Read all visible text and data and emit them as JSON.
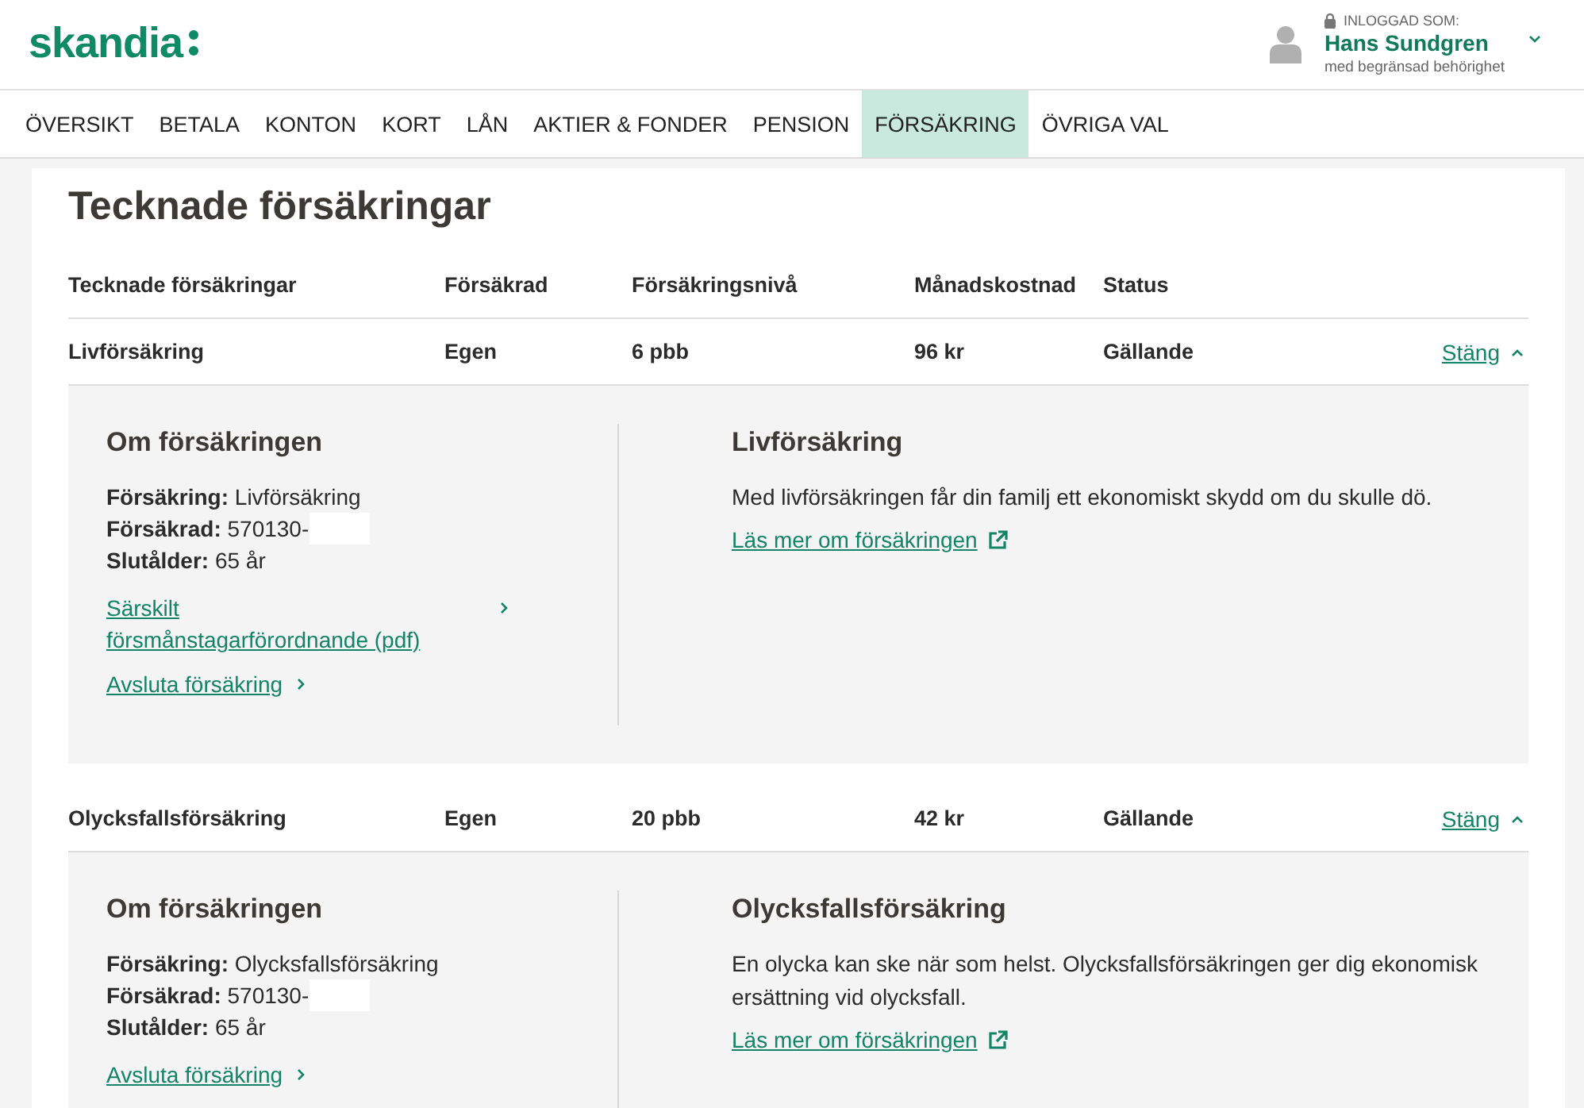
{
  "header": {
    "logo": "skandia",
    "login_label": "INLOGGAD SOM:",
    "user_name": "Hans Sundgren",
    "user_note": "med begränsad behörighet"
  },
  "nav": [
    {
      "label": "ÖVERSIKT",
      "selected": false
    },
    {
      "label": "BETALA",
      "selected": false
    },
    {
      "label": "KONTON",
      "selected": false
    },
    {
      "label": "KORT",
      "selected": false
    },
    {
      "label": "LÅN",
      "selected": false
    },
    {
      "label": "AKTIER & FONDER",
      "selected": false
    },
    {
      "label": "PENSION",
      "selected": false
    },
    {
      "label": "FÖRSÄKRING",
      "selected": true
    },
    {
      "label": "ÖVRIGA VAL",
      "selected": false
    }
  ],
  "page_title": "Tecknade försäkringar",
  "table": {
    "columns": [
      "Tecknade försäkringar",
      "Försäkrad",
      "Försäkringsnivå",
      "Månadskostnad",
      "Status"
    ],
    "rows": [
      {
        "cells": [
          "Livförsäkring",
          "Egen",
          "6 pbb",
          "96 kr",
          "Gällande"
        ],
        "toggle": "Stäng",
        "expanded": true,
        "details": {
          "heading": "Om försäkringen",
          "facts": [
            {
              "label": "Försäkring:",
              "value": "Livförsäkring"
            },
            {
              "label": "Försäkrad:",
              "value": "570130-",
              "redacted": true
            },
            {
              "label": "Slutålder:",
              "value": "65 år"
            }
          ],
          "links": [
            "Särskilt försmånstagarförordnande (pdf)",
            "Avsluta försäkring"
          ],
          "info_heading": "Livförsäkring",
          "info_text": "Med livförsäkringen får din familj ett ekonomiskt skydd om du skulle dö.",
          "read_more": "Läs mer om försäkringen"
        }
      },
      {
        "cells": [
          "Olycksfallsförsäkring",
          "Egen",
          "20 pbb",
          "42 kr",
          "Gällande"
        ],
        "toggle": "Stäng",
        "expanded": true,
        "details": {
          "heading": "Om försäkringen",
          "facts": [
            {
              "label": "Försäkring:",
              "value": "Olycksfallsförsäkring"
            },
            {
              "label": "Försäkrad:",
              "value": "570130-",
              "redacted": true
            },
            {
              "label": "Slutålder:",
              "value": "65 år"
            }
          ],
          "links": [
            "Avsluta försäkring"
          ],
          "info_heading": "Olycksfallsförsäkring",
          "info_text": "En olycka kan ske när som helst. Olycksfallsförsäkringen ger dig ekonomisk ersättning vid olycksfall.",
          "read_more": "Läs mer om försäkringen"
        }
      }
    ]
  }
}
